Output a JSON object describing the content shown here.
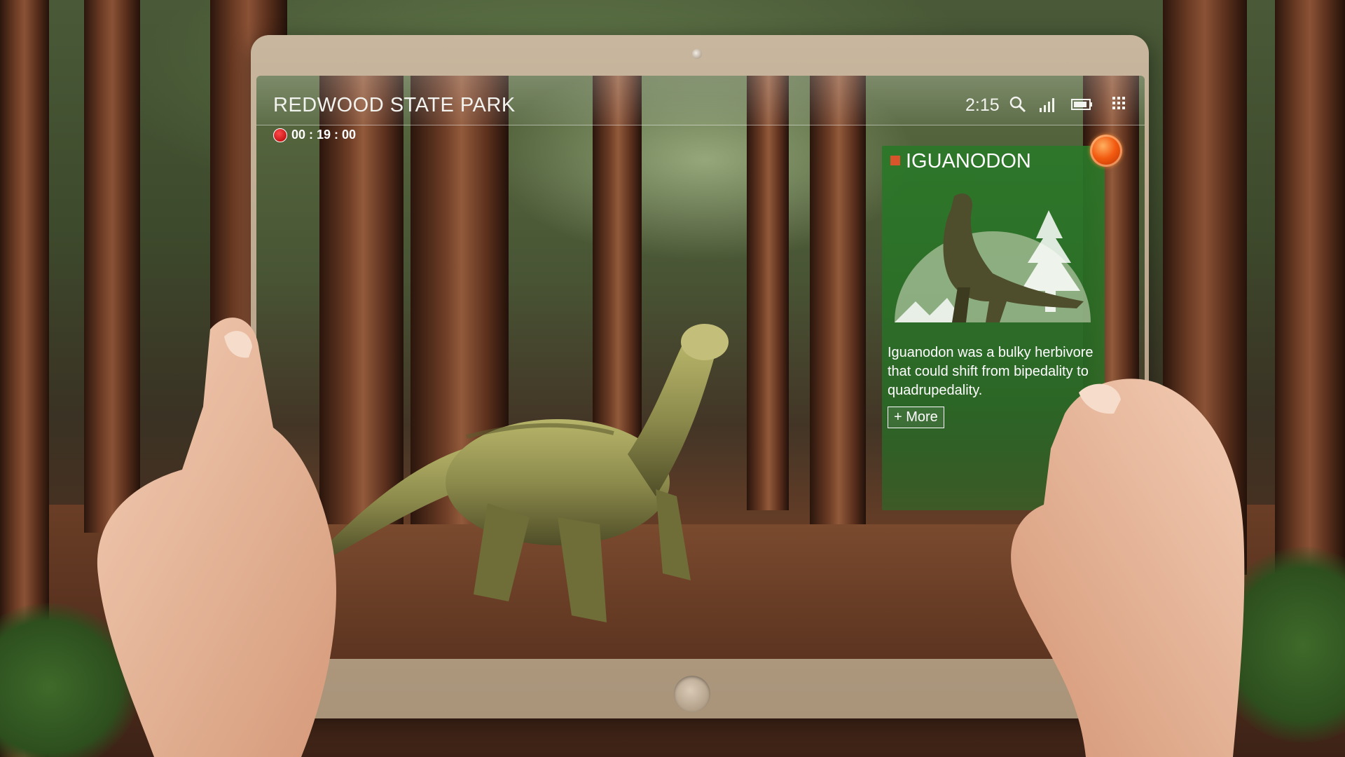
{
  "status_bar": {
    "park_name": "REDWOOD STATE PARK",
    "time": "2:15",
    "icons": [
      "search-icon",
      "signal-icon",
      "battery-icon",
      "grid-menu-icon"
    ]
  },
  "recording": {
    "elapsed": "00 : 19 : 00",
    "indicator_color": "#e00000"
  },
  "info_card": {
    "title": "IGUANODON",
    "description": "Iguanodon was a bulky herbivore that could shift from bipedality to quadrupedality.",
    "more_label": "+ More",
    "close_icon": "close-orb-icon",
    "accent_color": "#2e7a2a"
  },
  "colors": {
    "tablet_frame": "#c0ad93",
    "close_orb": "#f25a10"
  }
}
